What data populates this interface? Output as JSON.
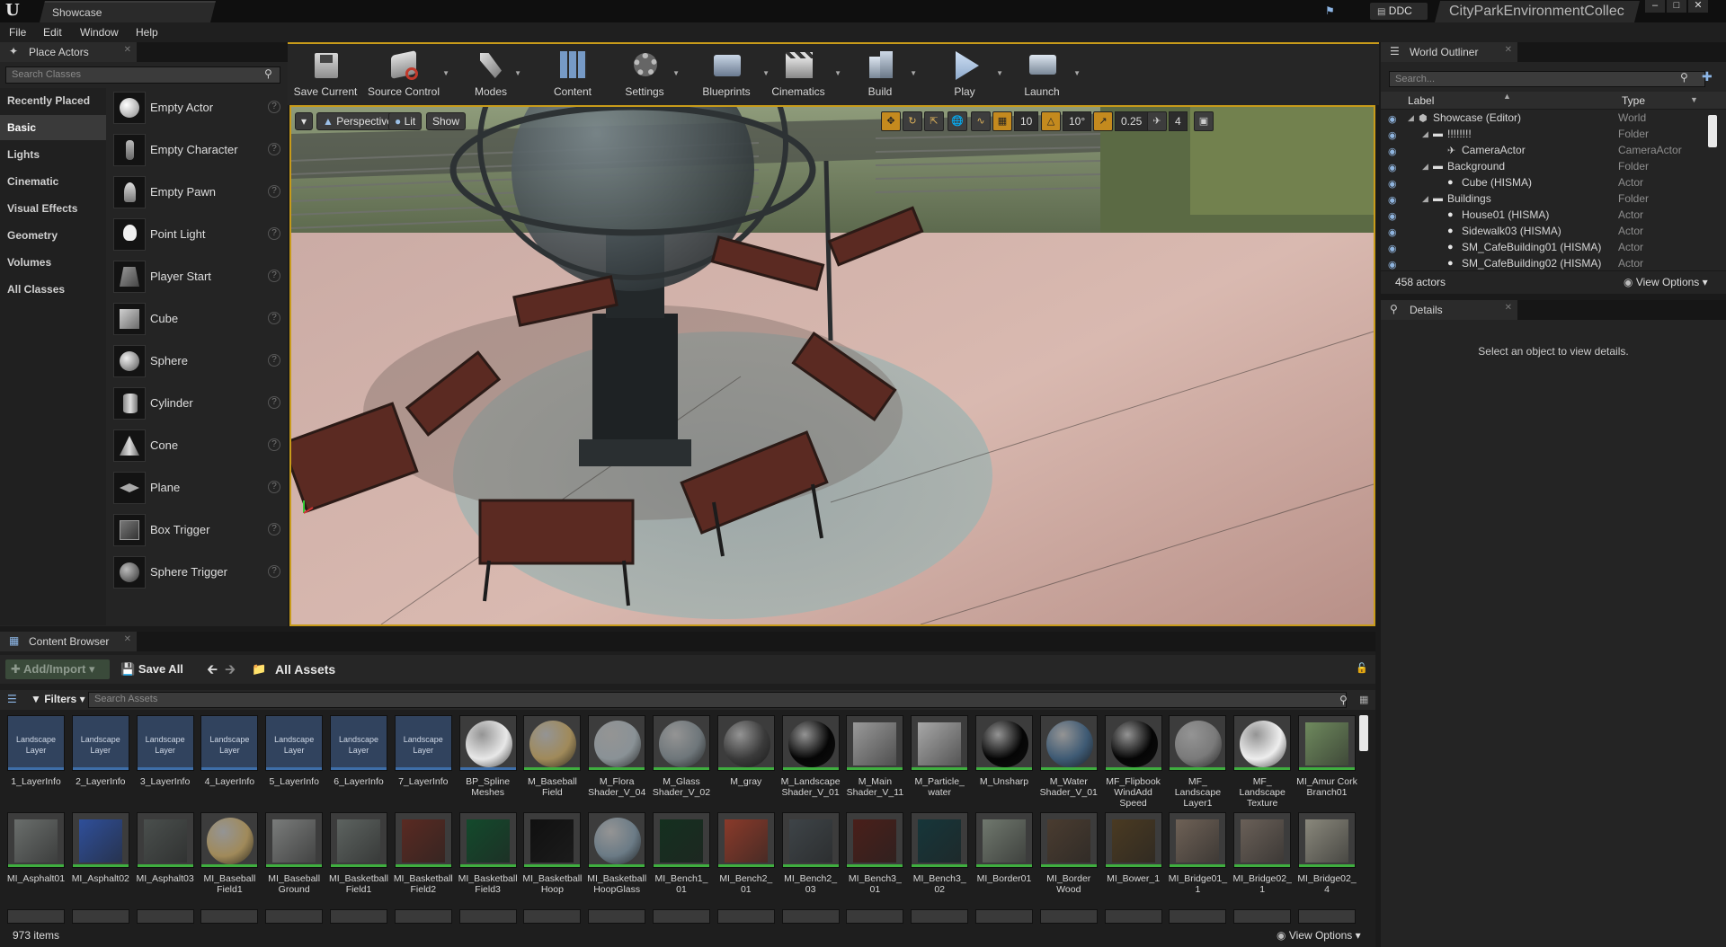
{
  "title_bar": {
    "logo": "U",
    "doc_tab": "Showcase",
    "ddc_label": "DDC",
    "project_tab": "CityParkEnvironmentCollec",
    "icons": [
      "unreal-logo-icon",
      "notification-icon",
      "ddc-icon",
      "minimize-icon",
      "maximize-icon",
      "close-icon"
    ]
  },
  "menu": [
    "File",
    "Edit",
    "Window",
    "Help"
  ],
  "place_actors": {
    "tab": "Place Actors",
    "search_placeholder": "Search Classes",
    "categories": [
      "Recently Placed",
      "Basic",
      "Lights",
      "Cinematic",
      "Visual Effects",
      "Geometry",
      "Volumes",
      "All Classes"
    ],
    "active_category": "Basic",
    "actors": [
      "Empty Actor",
      "Empty Character",
      "Empty Pawn",
      "Point Light",
      "Player Start",
      "Cube",
      "Sphere",
      "Cylinder",
      "Cone",
      "Plane",
      "Box Trigger",
      "Sphere Trigger"
    ]
  },
  "toolbar": {
    "buttons": [
      "Save Current",
      "Source Control",
      "Modes",
      "Content",
      "Settings",
      "Blueprints",
      "Cinematics",
      "Build",
      "Play",
      "Launch"
    ]
  },
  "viewport": {
    "perspective": "Perspective",
    "lit": "Lit",
    "show": "Show",
    "grid_snap": "10",
    "rotation_snap": "10°",
    "scale_snap": "0.25",
    "camera_speed": "4"
  },
  "world_outliner": {
    "tab": "World Outliner",
    "search_placeholder": "Search...",
    "col_label": "Label",
    "col_type": "Type",
    "rows": [
      {
        "label": "Showcase (Editor)",
        "type": "World",
        "indent": 0,
        "kind": "world"
      },
      {
        "label": "!!!!!!!!",
        "type": "Folder",
        "indent": 1,
        "kind": "folder"
      },
      {
        "label": "CameraActor",
        "type": "CameraActor",
        "indent": 2,
        "kind": "camera"
      },
      {
        "label": "Background",
        "type": "Folder",
        "indent": 1,
        "kind": "folder"
      },
      {
        "label": "Cube (HISMA)",
        "type": "Actor",
        "indent": 2,
        "kind": "actor"
      },
      {
        "label": "Buildings",
        "type": "Folder",
        "indent": 1,
        "kind": "folder"
      },
      {
        "label": "House01 (HISMA)",
        "type": "Actor",
        "indent": 2,
        "kind": "actor"
      },
      {
        "label": "Sidewalk03 (HISMA)",
        "type": "Actor",
        "indent": 2,
        "kind": "actor"
      },
      {
        "label": "SM_CafeBuilding01 (HISMA)",
        "type": "Actor",
        "indent": 2,
        "kind": "actor"
      },
      {
        "label": "SM_CafeBuilding02 (HISMA)",
        "type": "Actor",
        "indent": 2,
        "kind": "actor"
      }
    ],
    "actor_count": "458 actors",
    "view_options": "View Options"
  },
  "details": {
    "tab": "Details",
    "empty_message": "Select an object to view details."
  },
  "content_browser": {
    "tab": "Content Browser",
    "add_import": "Add/Import",
    "save_all": "Save All",
    "path": "All Assets",
    "filters": "Filters",
    "search_placeholder": "Search Assets",
    "landscape_layer_text": "Landscape Layer",
    "row1": [
      {
        "name": "1_LayerInfo",
        "kind": "landscape",
        "bar": "#3e6ea8"
      },
      {
        "name": "2_LayerInfo",
        "kind": "landscape",
        "bar": "#3e6ea8"
      },
      {
        "name": "3_LayerInfo",
        "kind": "landscape",
        "bar": "#3e6ea8"
      },
      {
        "name": "4_LayerInfo",
        "kind": "landscape",
        "bar": "#3e6ea8"
      },
      {
        "name": "5_LayerInfo",
        "kind": "landscape",
        "bar": "#3e6ea8"
      },
      {
        "name": "6_LayerInfo",
        "kind": "landscape",
        "bar": "#3e6ea8"
      },
      {
        "name": "7_LayerInfo",
        "kind": "landscape",
        "bar": "#3e6ea8"
      },
      {
        "name": "BP_Spline Meshes",
        "kind": "sphere",
        "color": "#e8e8e8",
        "bar": "#3e6ea8"
      },
      {
        "name": "M_Baseball Field",
        "kind": "sphere",
        "color": "#a08a5a",
        "bar": "#3fae3f"
      },
      {
        "name": "M_Flora Shader_V_04",
        "kind": "sphere",
        "color": "#8a9296",
        "bar": "#3fae3f"
      },
      {
        "name": "M_Glass Shader_V_02",
        "kind": "sphere",
        "color": "#6e767a",
        "bar": "#3fae3f"
      },
      {
        "name": "M_gray",
        "kind": "sphere",
        "color": "#3a3a3a",
        "bar": "#3fae3f"
      },
      {
        "name": "M_Landscape Shader_V_01",
        "kind": "sphere",
        "color": "#050505",
        "bar": "#3fae3f"
      },
      {
        "name": "M_Main Shader_V_11",
        "kind": "square",
        "color": "#9a9a9a",
        "bar": "#3fae3f"
      },
      {
        "name": "M_Particle_ water",
        "kind": "square",
        "color": "#a8a8a8",
        "bar": "#3fae3f"
      },
      {
        "name": "M_Unsharp",
        "kind": "sphere",
        "color": "#050505",
        "bar": "#3fae3f"
      },
      {
        "name": "M_Water Shader_V_01",
        "kind": "sphere",
        "color": "#3e5a74",
        "bar": "#3fae3f"
      },
      {
        "name": "MF_Flipbook WindAdd Speed",
        "kind": "sphere",
        "color": "#050505",
        "bar": "#3fae3f"
      },
      {
        "name": "MF_ Landscape Layer1",
        "kind": "sphere",
        "color": "#7a7a7a",
        "bar": "#3fae3f"
      },
      {
        "name": "MF_ Landscape Texture",
        "kind": "sphere",
        "color": "#eeeeee",
        "bar": "#3fae3f"
      },
      {
        "name": "MI_Amur Cork Branch01",
        "kind": "square",
        "color": "#6f8a5e",
        "bar": "#3fae3f"
      }
    ],
    "row2": [
      {
        "name": "MI_Asphalt01",
        "kind": "square",
        "color": "#6a6e6c",
        "bar": "#3fae3f"
      },
      {
        "name": "MI_Asphalt02",
        "kind": "square",
        "color": "#2f4f9a",
        "bar": "#3fae3f"
      },
      {
        "name": "MI_Asphalt03",
        "kind": "square",
        "color": "#4a4f4d",
        "bar": "#3fae3f"
      },
      {
        "name": "MI_Baseball Field1",
        "kind": "sphere",
        "color": "#a08a5a",
        "bar": "#3fae3f"
      },
      {
        "name": "MI_Baseball Ground",
        "kind": "square",
        "color": "#7a7c7b",
        "bar": "#3fae3f"
      },
      {
        "name": "MI_Basketball Field1",
        "kind": "square",
        "color": "#5d6360",
        "bar": "#3fae3f"
      },
      {
        "name": "MI_Basketball Field2",
        "kind": "square",
        "color": "#5a2a22",
        "bar": "#3fae3f"
      },
      {
        "name": "MI_Basketball Field3",
        "kind": "square",
        "color": "#134a2c",
        "bar": "#3fae3f"
      },
      {
        "name": "MI_Basketball Hoop",
        "kind": "square",
        "color": "#101010",
        "bar": "#3fae3f"
      },
      {
        "name": "MI_Basketball HoopGlass",
        "kind": "sphere",
        "color": "#6b7b86",
        "bar": "#3fae3f"
      },
      {
        "name": "MI_Bench1_ 01",
        "kind": "square",
        "color": "#14301f",
        "bar": "#3fae3f"
      },
      {
        "name": "MI_Bench2_ 01",
        "kind": "square",
        "color": "#8a3a2a",
        "bar": "#3fae3f"
      },
      {
        "name": "MI_Bench2_ 03",
        "kind": "square",
        "color": "#3e4448",
        "bar": "#3fae3f"
      },
      {
        "name": "MI_Bench3_ 01",
        "kind": "square",
        "color": "#4a1f1a",
        "bar": "#3fae3f"
      },
      {
        "name": "MI_Bench3_ 02",
        "kind": "square",
        "color": "#16363a",
        "bar": "#3fae3f"
      },
      {
        "name": "MI_Border01",
        "kind": "square",
        "color": "#70786e",
        "bar": "#3fae3f"
      },
      {
        "name": "MI_Border Wood",
        "kind": "square",
        "color": "#4a3c30",
        "bar": "#3fae3f"
      },
      {
        "name": "MI_Bower_1",
        "kind": "square",
        "color": "#4a3a22",
        "bar": "#3fae3f"
      },
      {
        "name": "MI_Bridge01_ 1",
        "kind": "square",
        "color": "#6e6156",
        "bar": "#3fae3f"
      },
      {
        "name": "MI_Bridge02_ 1",
        "kind": "square",
        "color": "#6a6058",
        "bar": "#3fae3f"
      },
      {
        "name": "MI_Bridge02_ 4",
        "kind": "square",
        "color": "#8a887c",
        "bar": "#3fae3f"
      }
    ],
    "item_count": "973 items",
    "view_options": "View Options"
  }
}
